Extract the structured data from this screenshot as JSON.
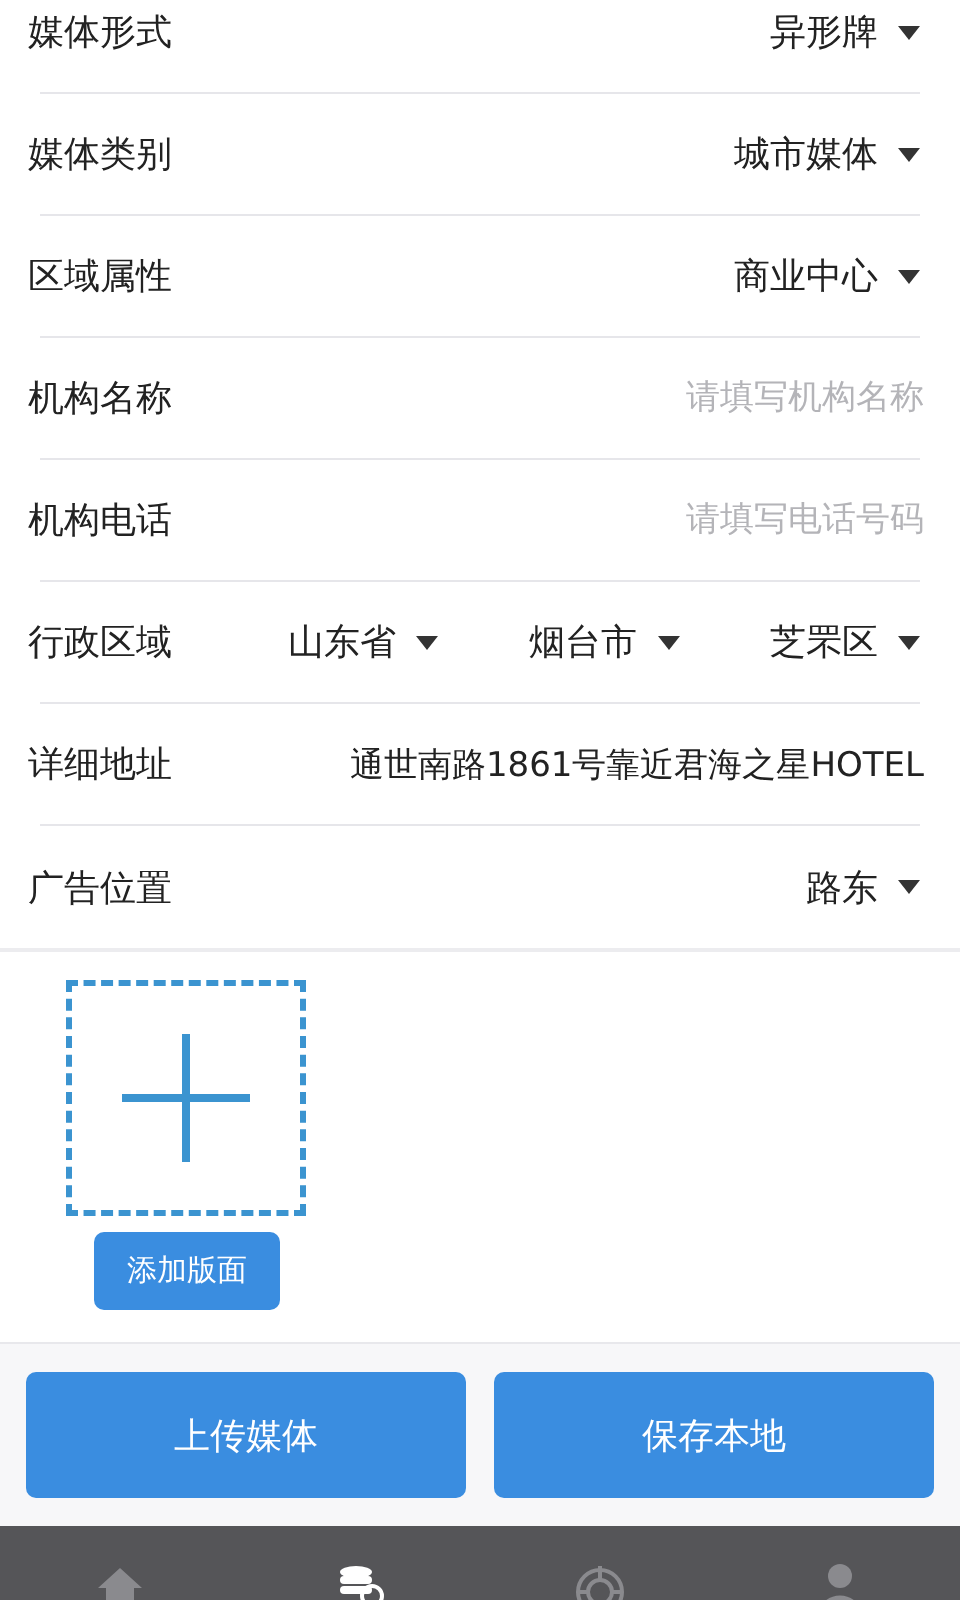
{
  "form": {
    "rows": [
      {
        "kind": "select",
        "label": "媒体形式",
        "value": "异形牌"
      },
      {
        "kind": "select",
        "label": "媒体类别",
        "value": "城市媒体"
      },
      {
        "kind": "select",
        "label": "区域属性",
        "value": "商业中心"
      },
      {
        "kind": "input",
        "label": "机构名称",
        "placeholder": "请填写机构名称"
      },
      {
        "kind": "input",
        "label": "机构电话",
        "placeholder": "请填写电话号码"
      },
      {
        "kind": "region",
        "label": "行政区域",
        "options": [
          "山东省",
          "烟台市",
          "芝罘区"
        ]
      },
      {
        "kind": "input",
        "label": "详细地址",
        "value": "通世南路1861号靠近君海之星HOTEL"
      },
      {
        "kind": "select",
        "label": "广告位置",
        "value": "路东"
      }
    ]
  },
  "add_panel": {
    "button": "添加版面"
  },
  "actions": [
    "上传媒体",
    "保存本地"
  ],
  "bottom_nav": [
    {
      "kind": "home",
      "selected": false
    },
    {
      "kind": "database-search",
      "selected": true
    },
    {
      "kind": "target",
      "selected": false
    },
    {
      "kind": "person",
      "selected": false
    }
  ]
}
